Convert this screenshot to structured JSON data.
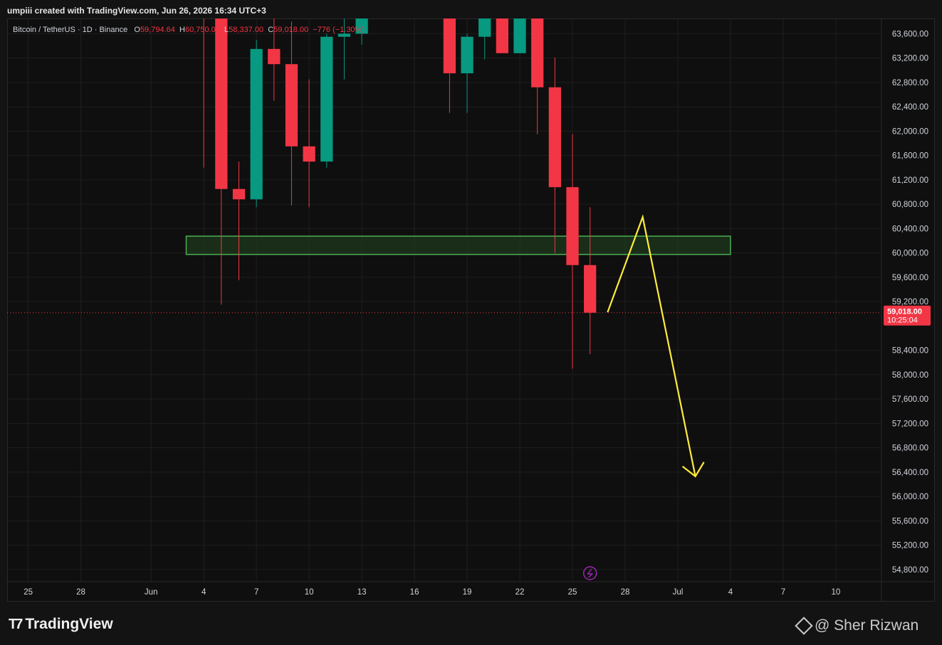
{
  "header": {
    "caption": "umpiii created with TradingView.com, Jun 26, 2026 16:34 UTC+3"
  },
  "ohlc": {
    "symbol": "Bitcoin / TetherUS · 1D · Binance",
    "open_label": "O",
    "open": "59,794.64",
    "high_label": "H",
    "high": "60,750.00",
    "low_label": "L",
    "low": "58,337.00",
    "close_label": "C",
    "close": "59,018.00",
    "change": "−776 (−1.30%)"
  },
  "price_badge": {
    "price": "59,018.00",
    "countdown": "10:25:04"
  },
  "footer": {
    "brand": "TradingView",
    "watermark": "@ Sher Rizwan"
  },
  "colors": {
    "up": "#089981",
    "down": "#f23645",
    "zone_stroke": "#4caf50",
    "zone_fill": "#1e3a1e",
    "arrow": "#ffeb3b",
    "alert_icon": "#9c27b0"
  },
  "chart_data": {
    "type": "candlestick",
    "y_ticks": [
      "63,600.00",
      "63,200.00",
      "62,800.00",
      "62,400.00",
      "62,000.00",
      "61,600.00",
      "61,200.00",
      "60,800.00",
      "60,400.00",
      "60,000.00",
      "59,600.00",
      "59,200.00",
      "58,400.00",
      "58,000.00",
      "57,600.00",
      "57,200.00",
      "56,800.00",
      "56,400.00",
      "56,000.00",
      "55,600.00",
      "55,200.00",
      "54,800.00"
    ],
    "y_tick_values": [
      63600,
      63200,
      62800,
      62400,
      62000,
      61600,
      61200,
      60800,
      60400,
      60000,
      59600,
      59200,
      58400,
      58000,
      57600,
      57200,
      56800,
      56400,
      56000,
      55600,
      55200,
      54800
    ],
    "x_ticks": [
      {
        "label": "25",
        "day": -6
      },
      {
        "label": "28",
        "day": -3
      },
      {
        "label": "Jun",
        "day": 1
      },
      {
        "label": "4",
        "day": 4
      },
      {
        "label": "7",
        "day": 7
      },
      {
        "label": "10",
        "day": 10
      },
      {
        "label": "13",
        "day": 13
      },
      {
        "label": "16",
        "day": 16
      },
      {
        "label": "19",
        "day": 19
      },
      {
        "label": "22",
        "day": 22
      },
      {
        "label": "25",
        "day": 25
      },
      {
        "label": "28",
        "day": 28
      },
      {
        "label": "Jul",
        "day": 31
      },
      {
        "label": "4",
        "day": 34
      },
      {
        "label": "7",
        "day": 37
      },
      {
        "label": "10",
        "day": 40
      }
    ],
    "candles": [
      {
        "day": 4,
        "o": 64500,
        "h": 65000,
        "l": 61400,
        "c": 64000
      },
      {
        "day": 5,
        "o": 64500,
        "h": 64800,
        "l": 59150,
        "c": 61050
      },
      {
        "day": 6,
        "o": 61050,
        "h": 61500,
        "l": 59550,
        "c": 60880
      },
      {
        "day": 7,
        "o": 60880,
        "h": 63500,
        "l": 60750,
        "c": 63350
      },
      {
        "day": 8,
        "o": 63350,
        "h": 64800,
        "l": 62500,
        "c": 63100
      },
      {
        "day": 9,
        "o": 63100,
        "h": 63800,
        "l": 60780,
        "c": 61750
      },
      {
        "day": 10,
        "o": 61750,
        "h": 62850,
        "l": 60750,
        "c": 61500
      },
      {
        "day": 11,
        "o": 61500,
        "h": 63600,
        "l": 61400,
        "c": 63550
      },
      {
        "day": 12,
        "o": 63550,
        "h": 64500,
        "l": 62850,
        "c": 63600
      },
      {
        "day": 13,
        "o": 63600,
        "h": 64500,
        "l": 63420,
        "c": 64300
      },
      {
        "day": 18,
        "o": 64500,
        "h": 64800,
        "l": 62300,
        "c": 62950
      },
      {
        "day": 19,
        "o": 62950,
        "h": 63600,
        "l": 62300,
        "c": 63550
      },
      {
        "day": 20,
        "o": 63550,
        "h": 64700,
        "l": 63180,
        "c": 64000
      },
      {
        "day": 21,
        "o": 64000,
        "h": 64500,
        "l": 63280,
        "c": 63280
      },
      {
        "day": 22,
        "o": 63280,
        "h": 64500,
        "l": 63280,
        "c": 64000
      },
      {
        "day": 23,
        "o": 64000,
        "h": 64500,
        "l": 61950,
        "c": 62720
      },
      {
        "day": 24,
        "o": 62720,
        "h": 63210,
        "l": 60000,
        "c": 61080
      },
      {
        "day": 25,
        "o": 61080,
        "h": 61950,
        "l": 58100,
        "c": 59800
      },
      {
        "day": 26,
        "o": 59800,
        "h": 60750,
        "l": 58337,
        "c": 59018
      }
    ],
    "zone": {
      "day_start": 3,
      "day_end": 34,
      "price_low": 59975,
      "price_high": 60275
    },
    "current_price": 59018,
    "projection": [
      {
        "day": 27,
        "price": 59025
      },
      {
        "day": 29,
        "price": 60590
      },
      {
        "day": 32,
        "price": 56330
      }
    ],
    "ylim": [
      54600,
      63850
    ],
    "xlim": [
      -7.2,
      42.6
    ],
    "grid": true
  }
}
